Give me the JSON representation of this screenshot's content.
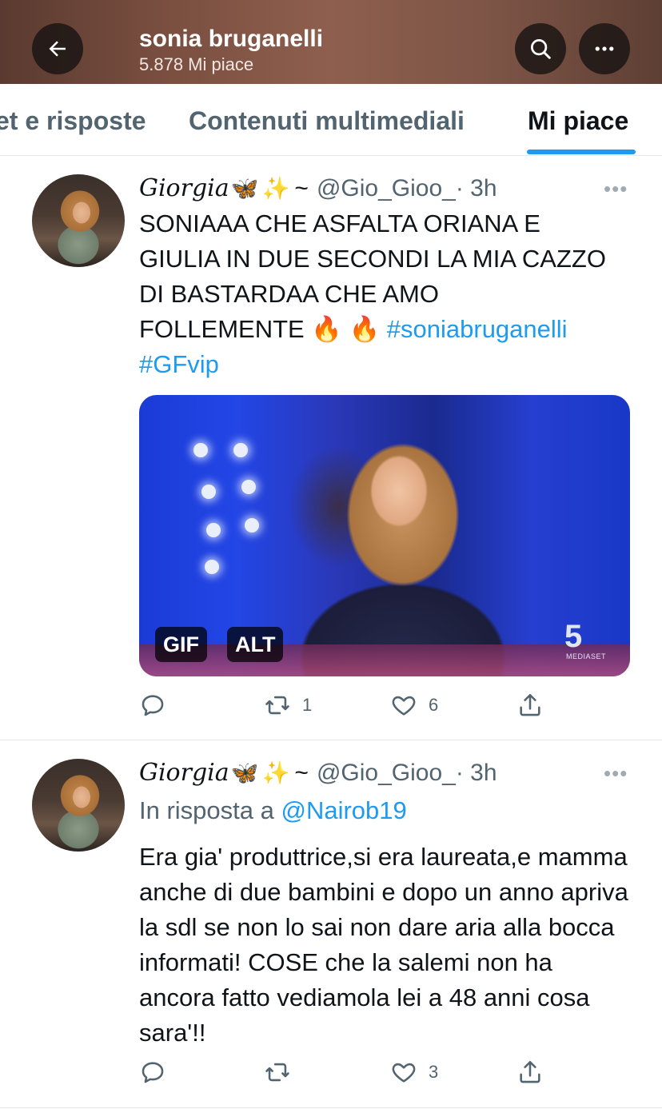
{
  "header": {
    "title": "sonia bruganelli",
    "subtitle": "5.878 Mi piace",
    "background_color": "#7a4f40"
  },
  "icons": {
    "back": "arrow-left-icon",
    "search": "search-icon",
    "more": "more-horizontal-icon",
    "reply": "comment-icon",
    "retweet": "retweet-icon",
    "like": "heart-icon",
    "share": "share-icon"
  },
  "tabs": [
    {
      "label": "et e risposte",
      "active": false
    },
    {
      "label": "Contenuti multimediali",
      "active": false
    },
    {
      "label": "Mi piace",
      "active": true
    }
  ],
  "colors": {
    "accent": "#1d9bf0",
    "secondary_text": "#536471",
    "primary_text": "#0f1419"
  },
  "tweets": [
    {
      "display_name": "Giorgia",
      "emoji_1": "🦋",
      "emoji_2": "✨",
      "tilde": "~",
      "handle": "@Gio_Gioo_",
      "time": "· 3h",
      "more": "•••",
      "text": "SONIAAA CHE ASFALTA ORIANA E GIULIA IN DUE SECONDI LA MIA CAZZO DI BASTARDAA CHE AMO FOLLEMENTE",
      "fire_emoji": "🔥 🔥",
      "hashtag_1": "#soniabruganelli",
      "hashtag_2": "#GFvip",
      "media": {
        "badge_gif": "GIF",
        "badge_alt": "ALT",
        "channel_logo": "5",
        "channel_sub": "MEDIASET"
      },
      "replies": "",
      "retweets": "1",
      "likes": "6"
    },
    {
      "display_name": "Giorgia",
      "emoji_1": "🦋",
      "emoji_2": "✨",
      "tilde": "~",
      "handle": "@Gio_Gioo_",
      "time": "· 3h",
      "more": "•••",
      "reply_prefix": "In risposta a",
      "reply_to": "@Nairob19",
      "text": "Era gia' produttrice,si era laureata,e mamma anche di due bambini e dopo un anno apriva la sdl se non lo sai non dare aria alla bocca informati! COSE che la salemi non ha ancora fatto vediamola lei a 48 anni cosa sara'!!",
      "replies": "",
      "retweets": "",
      "likes": "3"
    }
  ]
}
